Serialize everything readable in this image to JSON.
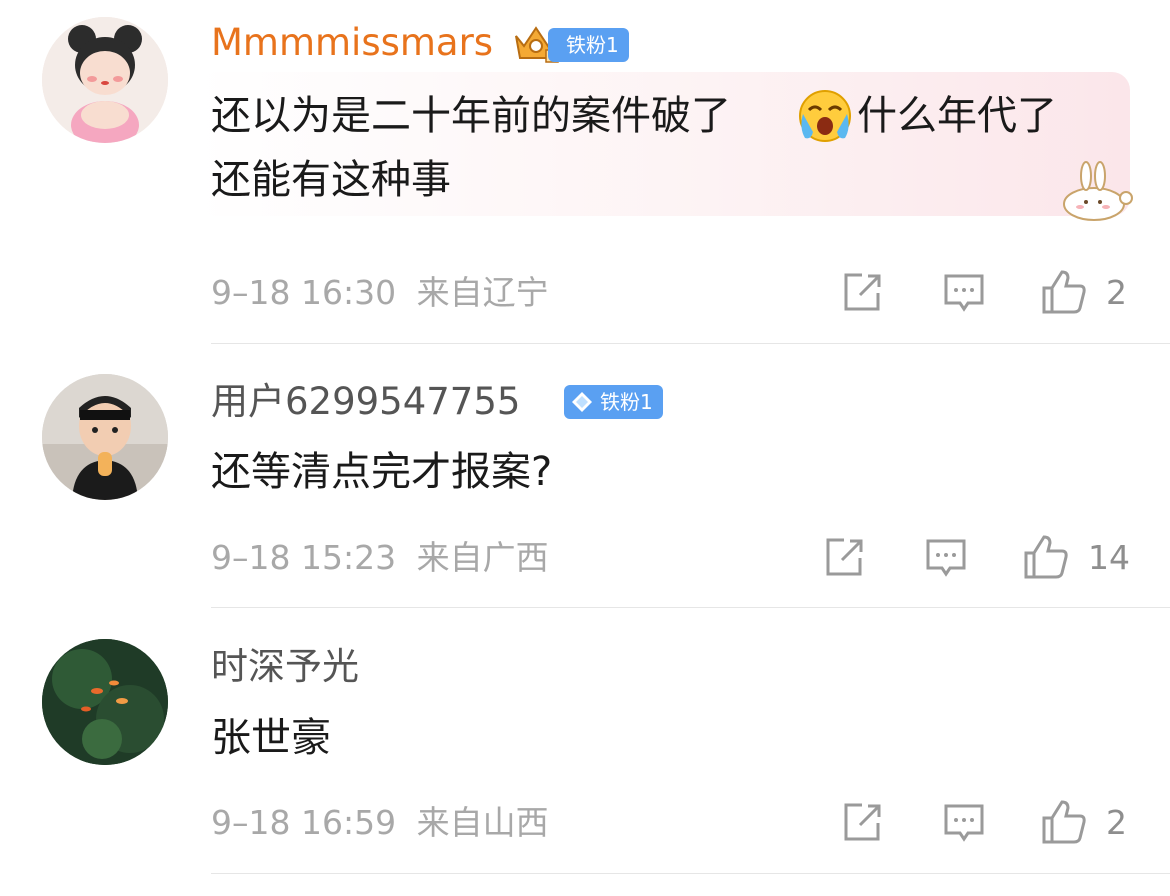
{
  "comments": [
    {
      "username": "Mmmmissmars",
      "badge": "铁粉1",
      "text_line1_a": "还以为是二十年前的案件破了",
      "emoji": "crying-face-icon",
      "text_line1_b": "什么年代了",
      "text_line2": "还能有这种事",
      "time": "9–18 16:30",
      "location": "来自辽宁",
      "likes": "2"
    },
    {
      "username": "用户6299547755",
      "badge": "铁粉1",
      "text": "还等清点完才报案?",
      "time": "9–18 15:23",
      "location": "来自广西",
      "likes": "14"
    },
    {
      "username": "时深予光",
      "text": "张世豪",
      "time": "9–18 16:59",
      "location": "来自山西",
      "likes": "2"
    }
  ],
  "colors": {
    "vip_name": "#e8731c",
    "name": "#555555",
    "badge": "#5aa0f2",
    "meta": "#a8a8a8",
    "icon": "#9a9a9a"
  }
}
